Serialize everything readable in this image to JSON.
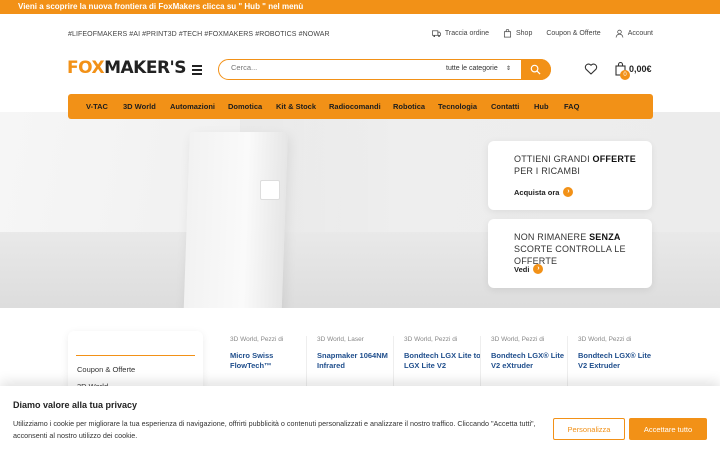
{
  "topbar": {
    "message": "Vieni a scoprire la nuova frontiera di FoxMakers clicca su \" Hub \" nel menù"
  },
  "utilbar": {
    "hashtags": "#LIFEOFMAKERS #AI #PRINT3D #TECH #FOXMAKERS #ROBOTICS #NOWAR",
    "links": [
      {
        "label": "Traccia ordine",
        "icon": "truck-icon"
      },
      {
        "label": "Shop",
        "icon": "bag-icon"
      },
      {
        "label": "Coupon & Offerte",
        "icon": ""
      },
      {
        "label": "Account",
        "icon": "user-icon"
      }
    ]
  },
  "header": {
    "logo_part1": "FOX",
    "logo_part2": "MAKER'S",
    "search_placeholder": "Cerca...",
    "search_category": "tutte le categorie",
    "cart_count": "0",
    "cart_total": "0,00€"
  },
  "nav": {
    "items": [
      "V-TAC",
      "3D World",
      "Automazioni",
      "Domotica",
      "Kit & Stock",
      "Radiocomandi",
      "Robotica",
      "Tecnologia",
      "Contatti",
      "Hub",
      "FAQ"
    ]
  },
  "promos": [
    {
      "pre": "OTTIENI GRANDI ",
      "bold": "OFFERTE",
      "post": " PER I RICAMBI",
      "cta": "Acquista ora"
    },
    {
      "pre": "NON RIMANERE ",
      "bold": "SENZA",
      "post": " SCORTE CONTROLLA LE OFFERTE",
      "cta": "Vedi"
    }
  ],
  "side_menu": {
    "items": [
      "Coupon & Offerte",
      "3D World"
    ]
  },
  "products": [
    {
      "category": "3D World, Pezzi di",
      "name": "Micro Swiss FlowTech™"
    },
    {
      "category": "3D World, Laser",
      "name": "Snapmaker 1064NM Infrared"
    },
    {
      "category": "3D World, Pezzi di",
      "name": "Bondtech LGX Lite to LGX Lite V2"
    },
    {
      "category": "3D World, Pezzi di",
      "name": "Bondtech LGX® Lite V2 eXtruder"
    },
    {
      "category": "3D World, Pezzi di",
      "name": "Bondtech LGX® Lite V2 Extruder"
    }
  ],
  "cookie": {
    "title": "Diamo valore alla tua privacy",
    "body": "Utilizziamo i cookie per migliorare la tua esperienza di navigazione, offrirti pubblicità o contenuti personalizzati e analizzare il nostro traffico. Cliccando \"Accetta tutti\", acconsenti al nostro utilizzo dei cookie.",
    "customize_label": "Personalizza",
    "accept_label": "Accettare tutto"
  },
  "colors": {
    "accent": "#f29117",
    "link": "#1f4e8c"
  }
}
